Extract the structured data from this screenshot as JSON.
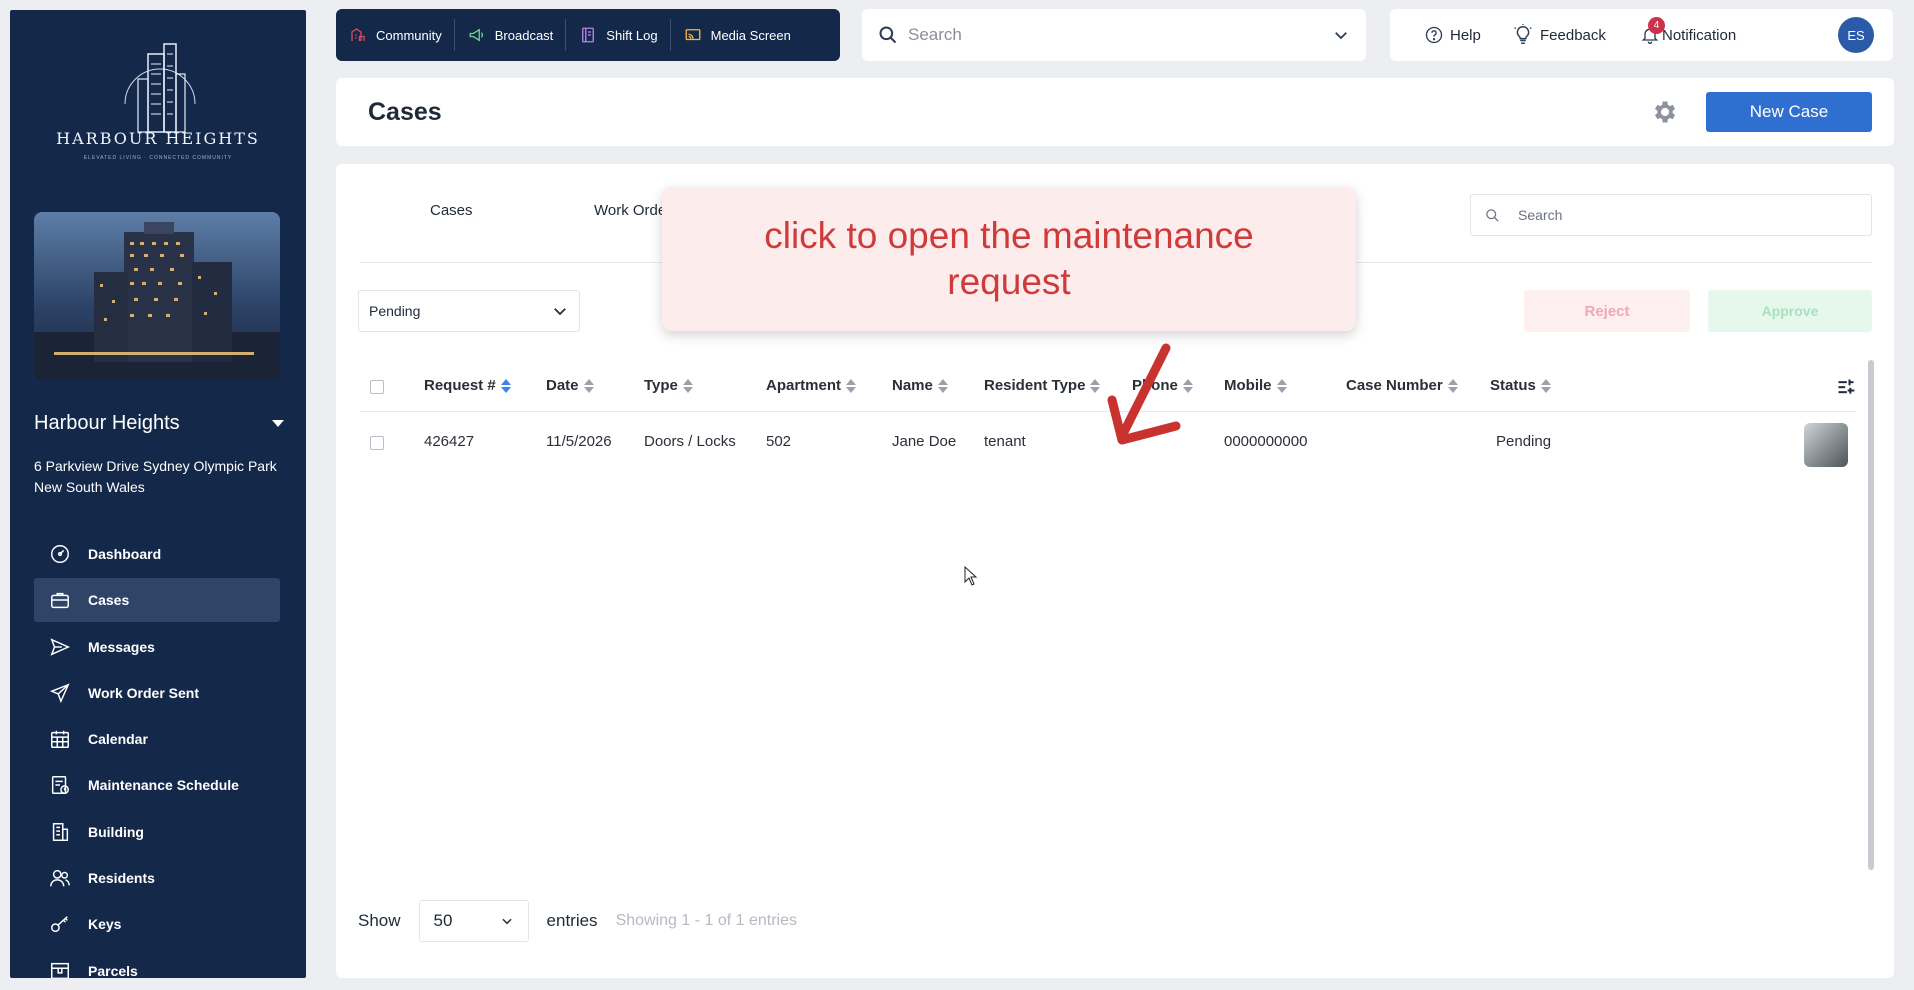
{
  "sidebar": {
    "logo_title": "HARBOUR HEIGHTS",
    "logo_tagline": "ELEVATED LIVING · CONNECTED COMMUNITY",
    "property_name": "Harbour Heights",
    "property_address": "6 Parkview Drive Sydney Olympic Park New South Wales",
    "items": [
      {
        "label": "Dashboard",
        "icon": "dashboard-icon"
      },
      {
        "label": "Cases",
        "icon": "briefcase-icon",
        "active": true
      },
      {
        "label": "Messages",
        "icon": "send-icon"
      },
      {
        "label": "Work Order Sent",
        "icon": "paper-plane-icon"
      },
      {
        "label": "Calendar",
        "icon": "calendar-icon"
      },
      {
        "label": "Maintenance Schedule",
        "icon": "schedule-icon"
      },
      {
        "label": "Building",
        "icon": "building-icon"
      },
      {
        "label": "Residents",
        "icon": "users-icon"
      },
      {
        "label": "Keys",
        "icon": "key-icon"
      },
      {
        "label": "Parcels",
        "icon": "parcel-icon"
      }
    ]
  },
  "toolbar": {
    "community": "Community",
    "broadcast": "Broadcast",
    "shift_log": "Shift Log",
    "media_screen": "Media Screen"
  },
  "global_search": {
    "placeholder": "Search"
  },
  "userbar": {
    "help": "Help",
    "feedback": "Feedback",
    "notification": "Notification",
    "notification_count": "4",
    "avatar_initials": "ES"
  },
  "page": {
    "title": "Cases",
    "new_button": "New Case"
  },
  "tabs": {
    "cases": "Cases",
    "work_order": "Work Orde"
  },
  "table_search": {
    "placeholder": "Search"
  },
  "filter": {
    "status_value": "Pending"
  },
  "actions": {
    "reject": "Reject",
    "approve": "Approve"
  },
  "table": {
    "columns": {
      "request": "Request #",
      "date": "Date",
      "type": "Type",
      "apartment": "Apartment",
      "name": "Name",
      "resident_type": "Resident Type",
      "phone": "Phone",
      "mobile": "Mobile",
      "case_number": "Case Number",
      "status": "Status"
    },
    "rows": [
      {
        "request": "426427",
        "date": "11/5/2026",
        "type": "Doors / Locks",
        "apartment": "502",
        "name": "Jane Doe",
        "resident_type": "tenant",
        "phone": "",
        "mobile": "0000000000",
        "case_number": "",
        "status": "Pending"
      }
    ]
  },
  "footer": {
    "show": "Show",
    "per_page": "50",
    "entries": "entries",
    "showing": "Showing 1 - 1 of 1 entries"
  },
  "callout": {
    "text": "click to open the maintenance request"
  },
  "colors": {
    "sidebar_bg": "#14284a",
    "primary": "#2f6fd0",
    "callout_text": "#cf3a3a",
    "callout_bg": "#fdecec"
  }
}
